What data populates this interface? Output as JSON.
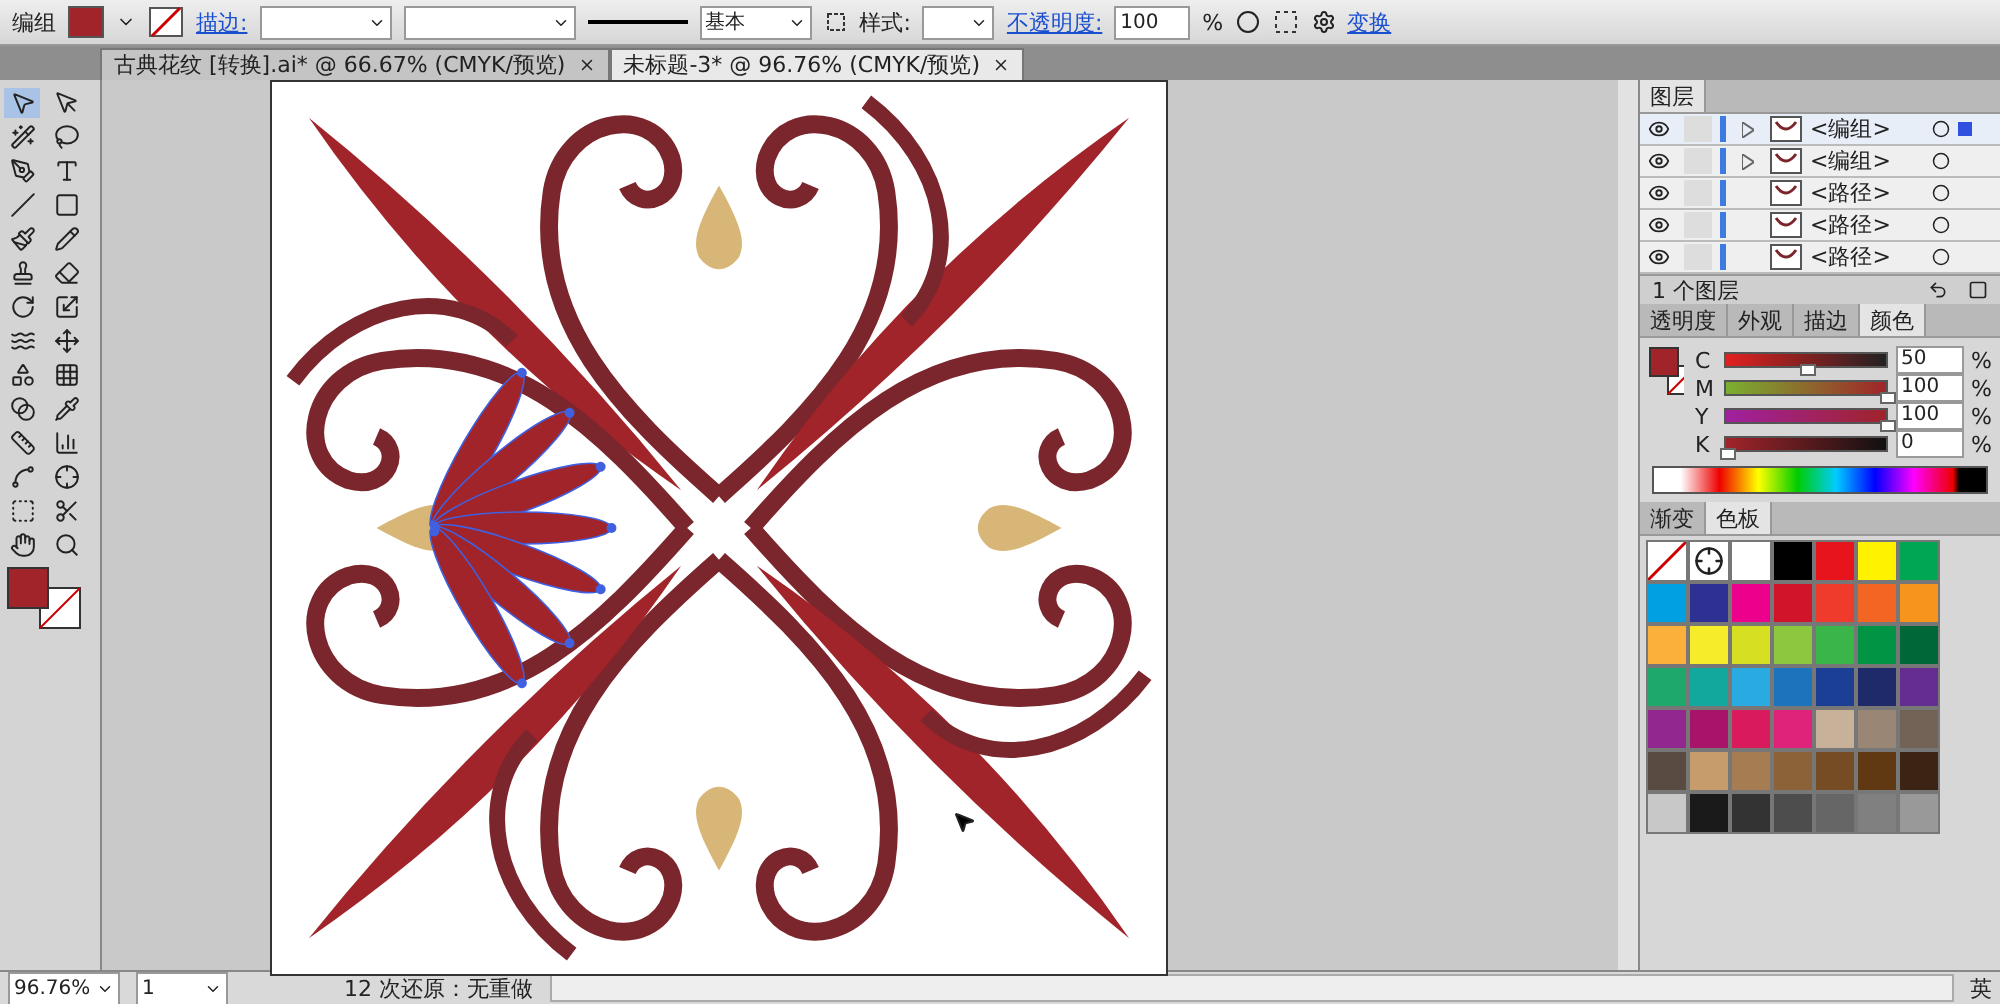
{
  "control_bar": {
    "selection": "编组",
    "stroke_link": "描边:",
    "stroke_line": "基本",
    "style_label": "样式:",
    "opacity_link": "不透明度:",
    "opacity": "100",
    "opacity_unit": "%",
    "transform_link": "变换"
  },
  "tabs": [
    {
      "label": "古典花纹 [转换].ai* @ 66.67% (CMYK/预览)",
      "selected": false
    },
    {
      "label": "未标题-3* @ 96.76% (CMYK/预览)",
      "selected": true
    }
  ],
  "layers_panel": {
    "tab": "图层",
    "rows": [
      {
        "name": "<编组>",
        "expandable": true,
        "selected": true
      },
      {
        "name": "<编组>",
        "expandable": true,
        "selected": false
      },
      {
        "name": "<路径>",
        "expandable": false,
        "selected": false
      },
      {
        "name": "<路径>",
        "expandable": false,
        "selected": false
      },
      {
        "name": "<路径>",
        "expandable": false,
        "selected": false
      }
    ],
    "footer": "1 个图层"
  },
  "color_panel": {
    "tabs": [
      {
        "label": "透明度",
        "selected": false
      },
      {
        "label": "外观",
        "selected": false
      },
      {
        "label": "描边",
        "selected": false
      },
      {
        "label": "颜色",
        "selected": true
      }
    ],
    "channels": [
      {
        "name": "C",
        "level": 0.5,
        "reading": "50",
        "unit": "%"
      },
      {
        "name": "M",
        "level": 1,
        "reading": "100",
        "unit": "%"
      },
      {
        "name": "Y",
        "level": 1,
        "reading": "100",
        "unit": "%"
      },
      {
        "name": "K",
        "level": 0,
        "reading": "0",
        "unit": "%"
      }
    ]
  },
  "swatches_panel": {
    "tabs": [
      {
        "label": "渐变",
        "selected": false
      },
      {
        "label": "色板",
        "selected": true
      }
    ],
    "swatches": [
      {
        "kind": "none"
      },
      {
        "kind": "registration"
      },
      {
        "kind": "color",
        "color": "#ffffff"
      },
      {
        "kind": "color",
        "color": "#000000"
      },
      {
        "kind": "color",
        "color": "#e8141c"
      },
      {
        "kind": "color",
        "color": "#fff200"
      },
      {
        "kind": "color",
        "color": "#00a651"
      },
      {
        "kind": "color",
        "color": "#00a0e3"
      },
      {
        "kind": "color",
        "color": "#2e3192"
      },
      {
        "kind": "color",
        "color": "#ec008c"
      },
      {
        "kind": "color",
        "color": "#d2142a"
      },
      {
        "kind": "color",
        "color": "#ef3b2c"
      },
      {
        "kind": "color",
        "color": "#f26522"
      },
      {
        "kind": "color",
        "color": "#f7941d"
      },
      {
        "kind": "color",
        "color": "#fbb03b"
      },
      {
        "kind": "color",
        "color": "#f7ec2a"
      },
      {
        "kind": "color",
        "color": "#d7df23"
      },
      {
        "kind": "color",
        "color": "#8dc63f"
      },
      {
        "kind": "color",
        "color": "#39b54a"
      },
      {
        "kind": "color",
        "color": "#009444"
      },
      {
        "kind": "color",
        "color": "#006838"
      },
      {
        "kind": "color",
        "color": "#1fa86b"
      },
      {
        "kind": "color",
        "color": "#13a89e"
      },
      {
        "kind": "color",
        "color": "#29abe2"
      },
      {
        "kind": "color",
        "color": "#1c75bc"
      },
      {
        "kind": "color",
        "color": "#1b3f94"
      },
      {
        "kind": "color",
        "color": "#1f2a6b"
      },
      {
        "kind": "color",
        "color": "#662d91"
      },
      {
        "kind": "color",
        "color": "#92278f"
      },
      {
        "kind": "color",
        "color": "#a8146a"
      },
      {
        "kind": "color",
        "color": "#d91a5c"
      },
      {
        "kind": "color",
        "color": "#e0237a"
      },
      {
        "kind": "color",
        "color": "#c7b299"
      },
      {
        "kind": "color",
        "color": "#998675"
      },
      {
        "kind": "color",
        "color": "#736357"
      },
      {
        "kind": "color",
        "color": "#594a42"
      },
      {
        "kind": "color",
        "color": "#c69c6d"
      },
      {
        "kind": "color",
        "color": "#a67c52"
      },
      {
        "kind": "color",
        "color": "#8c6239"
      },
      {
        "kind": "color",
        "color": "#754c24"
      },
      {
        "kind": "color",
        "color": "#603913"
      },
      {
        "kind": "color",
        "color": "#3c2415"
      },
      {
        "kind": "color",
        "color": "#c8c8c8"
      },
      {
        "kind": "color",
        "color": "#1a1a1a"
      },
      {
        "kind": "color",
        "color": "#333333"
      },
      {
        "kind": "color",
        "color": "#4d4d4d"
      },
      {
        "kind": "color",
        "color": "#666666"
      },
      {
        "kind": "color",
        "color": "#808080"
      },
      {
        "kind": "color",
        "color": "#999999"
      }
    ]
  },
  "status_bar": {
    "zoom": "96.76%",
    "page": "1",
    "history": "12 次还原：无重做",
    "ime": "英"
  }
}
